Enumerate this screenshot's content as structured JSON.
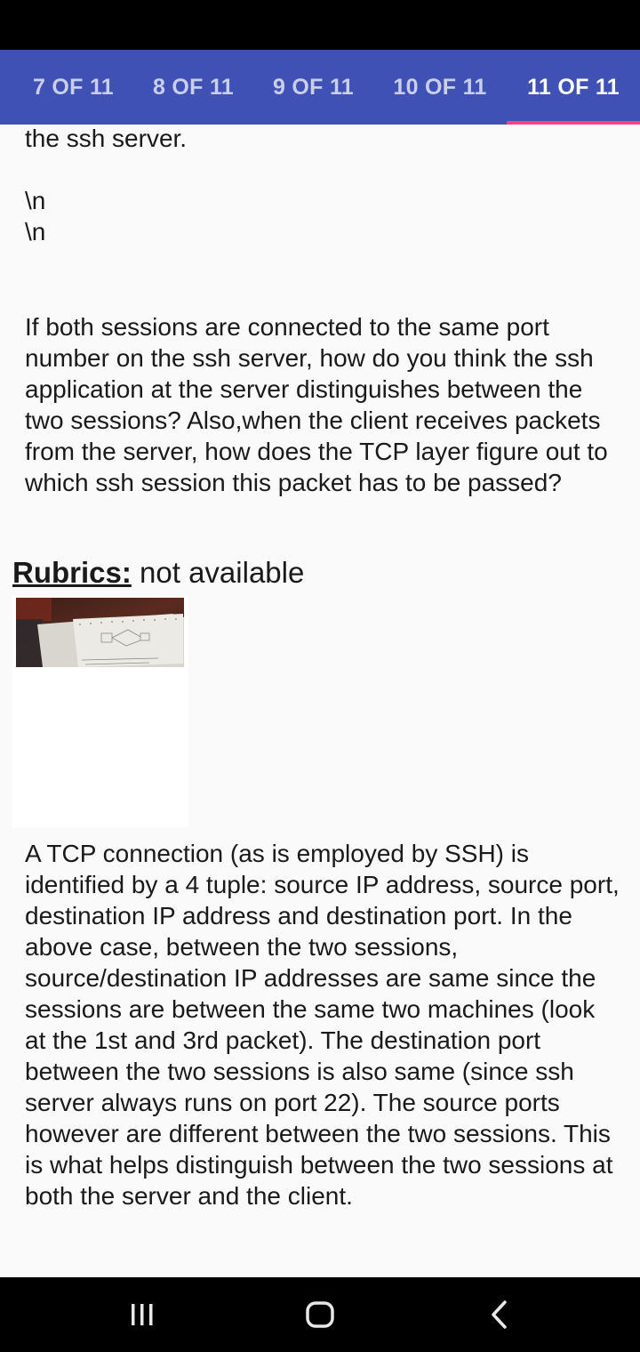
{
  "tabs": [
    {
      "label": "7 OF 11",
      "active": false
    },
    {
      "label": "8 OF 11",
      "active": false
    },
    {
      "label": "9 OF 11",
      "active": false
    },
    {
      "label": "10 OF 11",
      "active": false
    },
    {
      "label": "11 OF 11",
      "active": true
    }
  ],
  "colors": {
    "tab_bar": "#3f51b5",
    "tab_indicator": "#ff4081",
    "background": "#fafafa",
    "system_bars": "#000000"
  },
  "question": {
    "partial_line": "the ssh server.",
    "escape_lines": [
      "\\n",
      "\\n"
    ],
    "text": "If both sessions are connected to the same port number on the ssh server, how do you think the ssh application at the server distinguishes between the two sessions? Also,when the client receives packets from the server, how does the TCP layer figure out to which ssh session this packet has to be passed?"
  },
  "rubrics": {
    "label": "Rubrics:",
    "value": " not available"
  },
  "answer": {
    "text": "A TCP connection (as is employed by SSH) is identified by a 4 tuple: source IP address, source port, destination IP address and destination port. In the above case, between the two sessions, source/destination IP addresses are same since the sessions are between the same two machines (look at the 1st and 3rd packet). The destination port between the two sessions is also same (since ssh server always runs on port 22). The source ports however are different between the two sessions. This is what helps distinguish between the two sessions at both the server and the client."
  },
  "nav_icons": [
    "recent-apps-icon",
    "home-icon",
    "back-icon"
  ]
}
